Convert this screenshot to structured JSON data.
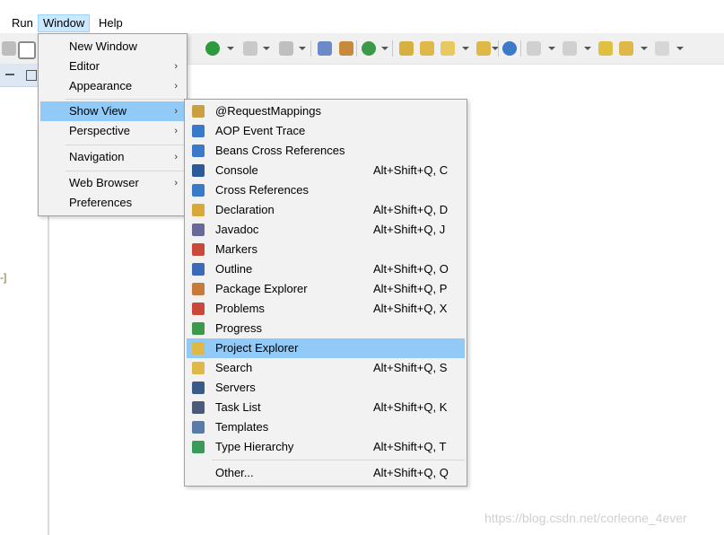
{
  "menubar": {
    "run": "Run",
    "window": "Window",
    "help": "Help"
  },
  "window_menu": {
    "new_window": "New Window",
    "editor": "Editor",
    "appearance": "Appearance",
    "show_view": "Show View",
    "perspective": "Perspective",
    "navigation": "Navigation",
    "web_browser": "Web Browser",
    "preferences": "Preferences",
    "submenu_arrow": "›"
  },
  "show_view_menu": {
    "items": [
      {
        "label": "@RequestMappings",
        "shortcut": "",
        "icon": "request-mappings-icon",
        "color": "#c8a040"
      },
      {
        "label": "AOP Event Trace",
        "shortcut": "",
        "icon": "aop-event-trace-icon",
        "color": "#3a78c8"
      },
      {
        "label": "Beans Cross References",
        "shortcut": "",
        "icon": "beans-cross-references-icon",
        "color": "#3a7ac8"
      },
      {
        "label": "Console",
        "shortcut": "Alt+Shift+Q, C",
        "icon": "console-icon",
        "color": "#2a5a9a"
      },
      {
        "label": "Cross References",
        "shortcut": "",
        "icon": "cross-references-icon",
        "color": "#3a7ac8"
      },
      {
        "label": "Declaration",
        "shortcut": "Alt+Shift+Q, D",
        "icon": "declaration-icon",
        "color": "#d8a838"
      },
      {
        "label": "Javadoc",
        "shortcut": "Alt+Shift+Q, J",
        "icon": "javadoc-icon",
        "color": "#6a6a9a"
      },
      {
        "label": "Markers",
        "shortcut": "",
        "icon": "markers-icon",
        "color": "#c84a3a"
      },
      {
        "label": "Outline",
        "shortcut": "Alt+Shift+Q, O",
        "icon": "outline-icon",
        "color": "#3a6ab8"
      },
      {
        "label": "Package Explorer",
        "shortcut": "Alt+Shift+Q, P",
        "icon": "package-explorer-icon",
        "color": "#c87a3a"
      },
      {
        "label": "Problems",
        "shortcut": "Alt+Shift+Q, X",
        "icon": "problems-icon",
        "color": "#c84a3a"
      },
      {
        "label": "Progress",
        "shortcut": "",
        "icon": "progress-icon",
        "color": "#3a9a4a"
      },
      {
        "label": "Project Explorer",
        "shortcut": "",
        "icon": "project-explorer-icon",
        "color": "#e0b848"
      },
      {
        "label": "Search",
        "shortcut": "Alt+Shift+Q, S",
        "icon": "search-icon",
        "color": "#e0b848"
      },
      {
        "label": "Servers",
        "shortcut": "",
        "icon": "servers-icon",
        "color": "#3a5a8a"
      },
      {
        "label": "Task List",
        "shortcut": "Alt+Shift+Q, K",
        "icon": "task-list-icon",
        "color": "#4a5a7a"
      },
      {
        "label": "Templates",
        "shortcut": "",
        "icon": "templates-icon",
        "color": "#5a7aa8"
      },
      {
        "label": "Type Hierarchy",
        "shortcut": "Alt+Shift+Q, T",
        "icon": "type-hierarchy-icon",
        "color": "#3a9a5a"
      },
      {
        "label": "Other...",
        "shortcut": "Alt+Shift+Q, Q",
        "icon": "",
        "color": ""
      }
    ],
    "highlighted": "Project Explorer"
  },
  "watermark": "https://blog.csdn.net/corleone_4ever",
  "left_panel": {
    "bracket": "-]"
  },
  "colors": {
    "highlight": "#91c9f7",
    "menu_bg": "#f2f2f2",
    "menubar_active": "#cce8ff"
  }
}
